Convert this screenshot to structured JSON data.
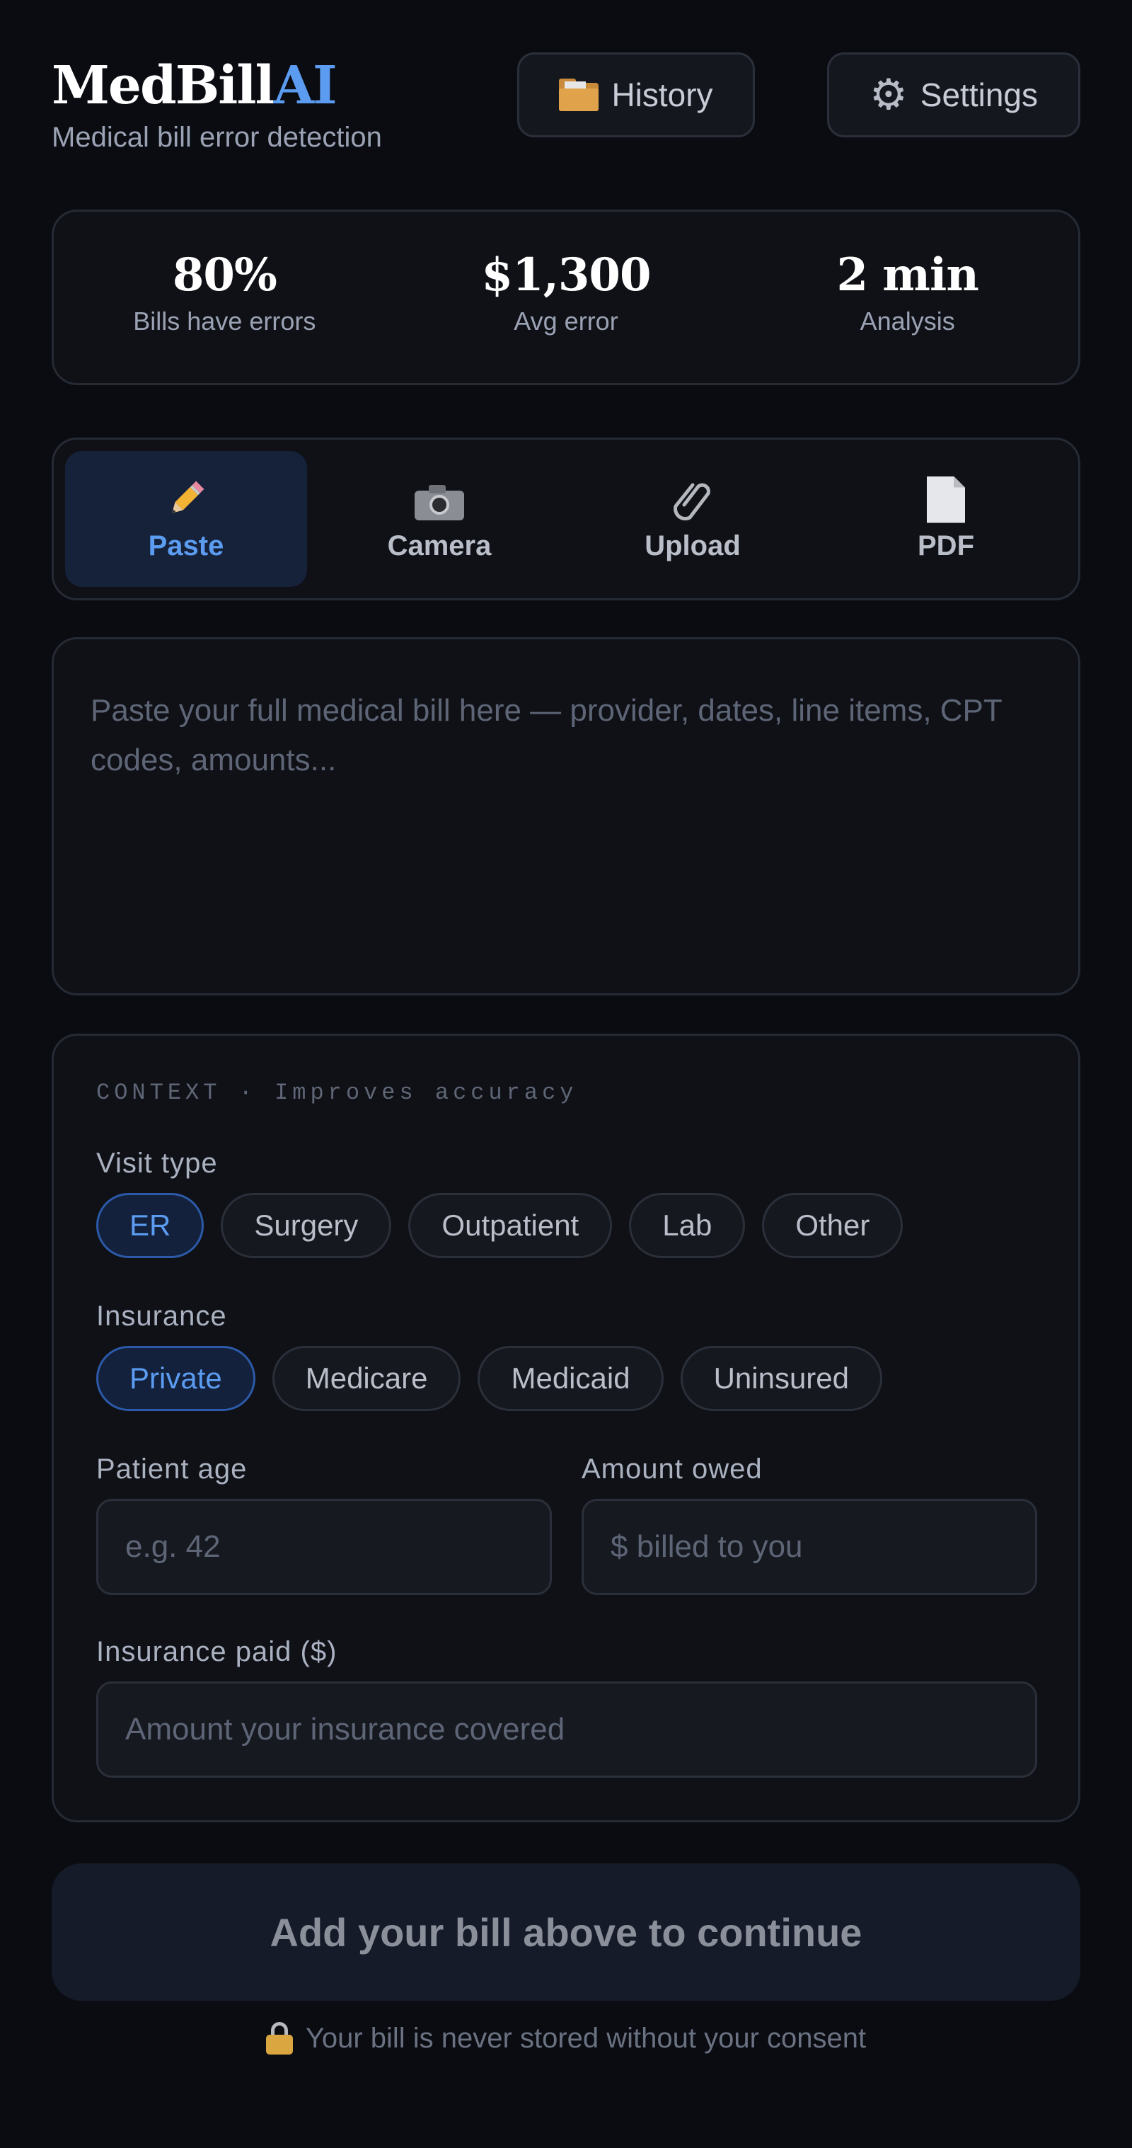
{
  "app": {
    "logo_main": "MedBill",
    "logo_accent": "AI",
    "tagline": "Medical bill error detection"
  },
  "header": {
    "history_label": "History",
    "history_icon": "folder-icon",
    "settings_label": "Settings",
    "settings_icon": "gear-icon"
  },
  "stats": [
    {
      "value": "80%",
      "label": "Bills have errors"
    },
    {
      "value": "$1,300",
      "label": "Avg error"
    },
    {
      "value": "2 min",
      "label": "Analysis"
    }
  ],
  "input_tabs": [
    {
      "label": "Paste",
      "icon": "pencil-icon",
      "active": true
    },
    {
      "label": "Camera",
      "icon": "camera-icon",
      "active": false
    },
    {
      "label": "Upload",
      "icon": "paperclip-icon",
      "active": false
    },
    {
      "label": "PDF",
      "icon": "document-icon",
      "active": false
    }
  ],
  "bill_input": {
    "placeholder": "Paste your full medical bill here — provider, dates, line items, CPT codes, amounts...",
    "value": ""
  },
  "context": {
    "title": "CONTEXT · Improves accuracy",
    "visit_type": {
      "label": "Visit type",
      "options": [
        "ER",
        "Surgery",
        "Outpatient",
        "Lab",
        "Other"
      ],
      "selected": "ER"
    },
    "insurance": {
      "label": "Insurance",
      "options": [
        "Private",
        "Medicare",
        "Medicaid",
        "Uninsured"
      ],
      "selected": "Private"
    },
    "patient_age": {
      "label": "Patient age",
      "placeholder": "e.g. 42",
      "value": ""
    },
    "amount_owed": {
      "label": "Amount owed",
      "placeholder": "$ billed to you",
      "value": ""
    },
    "insurance_paid": {
      "label": "Insurance paid ($)",
      "placeholder": "Amount your insurance covered",
      "value": ""
    }
  },
  "cta": {
    "label": "Add your bill above to continue"
  },
  "privacy_note": {
    "text": "Your bill is never stored without your consent",
    "icon": "lock-icon"
  },
  "colors": {
    "background": "#0a0c12",
    "accent": "#5b9cf0",
    "card": "#0f1116",
    "border": "#262a34"
  }
}
